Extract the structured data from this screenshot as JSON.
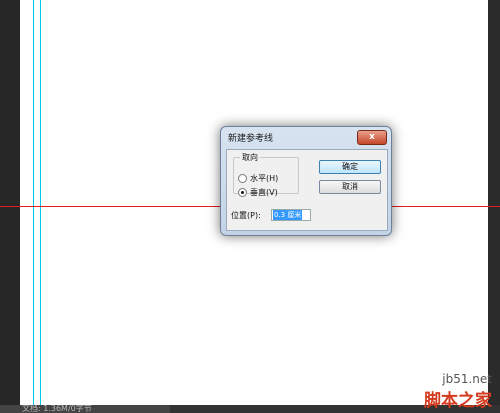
{
  "dialog": {
    "title": "新建参考线",
    "close_glyph": "x",
    "orientation_legend": "取向",
    "options": [
      {
        "label": "水平(H)",
        "checked": false
      },
      {
        "label": "垂直(V)",
        "checked": true
      }
    ],
    "ok_label": "确定",
    "cancel_label": "取消",
    "position_label": "位置(P):",
    "position_value": "0.3 厘米"
  },
  "status_bar": {
    "text": "文档: 1.36M/0字节"
  },
  "watermark": {
    "site": "jb51.net",
    "name": "脚本之家"
  },
  "colors": {
    "vertical_guide": "#00c8e8",
    "horizontal_guide": "#e21f1f",
    "canvas": "#ffffff",
    "workspace": "#2b2b2b"
  }
}
